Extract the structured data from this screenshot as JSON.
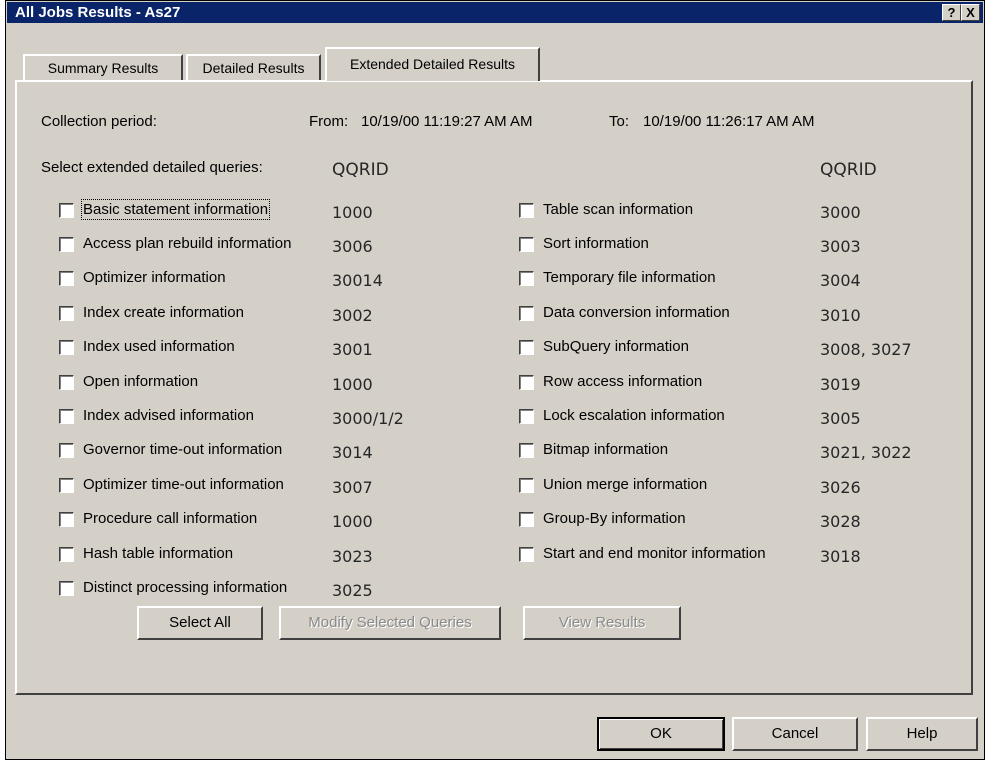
{
  "window": {
    "title": "All Jobs Results - As27"
  },
  "titlebar": {
    "help_label": "?",
    "close_label": "X"
  },
  "tabs": [
    {
      "label": "Summary Results",
      "active": false
    },
    {
      "label": "Detailed Results",
      "active": false
    },
    {
      "label": "Extended Detailed Results",
      "active": true
    }
  ],
  "collection": {
    "label": "Collection period:",
    "from_label": "From:",
    "from_value": "10/19/00  11:19:27 AM  AM",
    "to_label": "To:",
    "to_value": "10/19/00  11:26:17 AM  AM"
  },
  "queries": {
    "label": "Select extended detailed queries:",
    "qqrid_header_left": "QQRID",
    "qqrid_header_right": "QQRID",
    "left": [
      {
        "label": "Basic statement information",
        "qqrid": "1000",
        "checked": false
      },
      {
        "label": "Access plan rebuild information",
        "qqrid": "3006",
        "checked": false
      },
      {
        "label": "Optimizer information",
        "qqrid": "30014",
        "checked": false
      },
      {
        "label": "Index create information",
        "qqrid": "3002",
        "checked": false
      },
      {
        "label": "Index used information",
        "qqrid": "3001",
        "checked": false
      },
      {
        "label": "Open information",
        "qqrid": "1000",
        "checked": false
      },
      {
        "label": "Index advised information",
        "qqrid": "3000/1/2",
        "checked": false
      },
      {
        "label": "Governor time-out information",
        "qqrid": "3014",
        "checked": false
      },
      {
        "label": "Optimizer time-out information",
        "qqrid": "3007",
        "checked": false
      },
      {
        "label": "Procedure call information",
        "qqrid": "1000",
        "checked": false
      },
      {
        "label": "Hash table information",
        "qqrid": "3023",
        "checked": false
      },
      {
        "label": "Distinct processing information",
        "qqrid": "3025",
        "checked": false
      }
    ],
    "right": [
      {
        "label": "Table scan information",
        "qqrid": "3000",
        "checked": false
      },
      {
        "label": "Sort information",
        "qqrid": "3003",
        "checked": false
      },
      {
        "label": "Temporary file information",
        "qqrid": "3004",
        "checked": false
      },
      {
        "label": "Data conversion information",
        "qqrid": "3010",
        "checked": false
      },
      {
        "label": "SubQuery information",
        "qqrid": "3008, 3027",
        "checked": false
      },
      {
        "label": "Row access information",
        "qqrid": "3019",
        "checked": false
      },
      {
        "label": "Lock escalation information",
        "qqrid": "3005",
        "checked": false
      },
      {
        "label": "Bitmap information",
        "qqrid": "3021, 3022",
        "checked": false
      },
      {
        "label": "Union merge information",
        "qqrid": "3026",
        "checked": false
      },
      {
        "label": "Group-By information",
        "qqrid": "3028",
        "checked": false
      },
      {
        "label": "Start and end monitor information",
        "qqrid": "3018",
        "checked": false
      }
    ]
  },
  "actions": {
    "select_all": "Select All",
    "modify_selected": "Modify Selected Queries",
    "view_results": "View Results"
  },
  "footer": {
    "ok": "OK",
    "cancel": "Cancel",
    "help": "Help"
  },
  "colors": {
    "title_bar": "#0a246a",
    "dialog_bg": "#d4d0c8"
  }
}
